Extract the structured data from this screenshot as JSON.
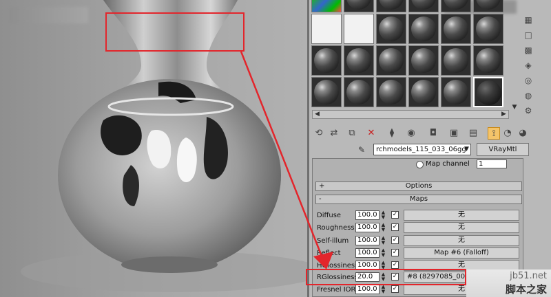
{
  "material_editor": {
    "material_name": "rchmodels_115_033_06gg",
    "material_type": "VRayMtl",
    "map_channel_label": "Map channel",
    "map_channel_value": "1",
    "rollouts": {
      "options": {
        "sign": "+",
        "title": "Options"
      },
      "maps": {
        "sign": "-",
        "title": "Maps"
      }
    },
    "maps": [
      {
        "label": "Diffuse",
        "amount": "100.0",
        "map": "无"
      },
      {
        "label": "Roughness",
        "amount": "100.0",
        "map": "无"
      },
      {
        "label": "Self-illum",
        "amount": "100.0",
        "map": "无"
      },
      {
        "label": "Reflect",
        "amount": "100.0",
        "map": "Map #6 (Falloff)"
      },
      {
        "label": "HGlossiness",
        "amount": "100.0",
        "map": "无"
      },
      {
        "label": "RGlossiness",
        "amount": "20.0",
        "map": "#8 (8297085_000"
      },
      {
        "label": "Fresnel IOR",
        "amount": "100.0",
        "map": "无"
      }
    ]
  },
  "logo": {
    "url": "jb51.net",
    "name": "脚本之家"
  },
  "colors": {
    "highlight": "#e3252b",
    "active_tool": "#f4c46a"
  }
}
